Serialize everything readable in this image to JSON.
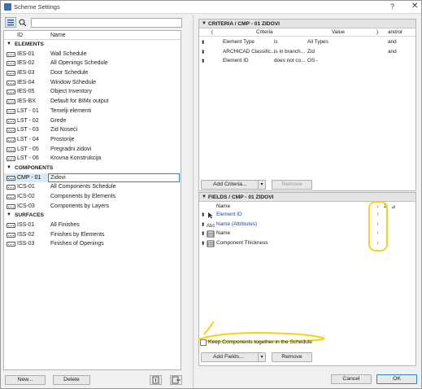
{
  "window": {
    "title": "Scheme Settings",
    "help": "?",
    "close": "✕"
  },
  "left": {
    "headers": {
      "id": "ID",
      "name": "Name"
    },
    "categories": {
      "elements": "ELEMENTS",
      "components": "COMPONENTS",
      "surfaces": "SURFACES"
    },
    "elements": [
      {
        "id": "IES-01",
        "name": "Wall Schedule"
      },
      {
        "id": "IES-02",
        "name": "All Openings Schedule"
      },
      {
        "id": "IES-03",
        "name": "Door Schedule"
      },
      {
        "id": "IES-04",
        "name": "Window Schedule"
      },
      {
        "id": "IES-05",
        "name": "Object Inventory"
      },
      {
        "id": "IES-BX",
        "name": "Default for BIMx output"
      },
      {
        "id": "LST - 01",
        "name": "Temelji elementi"
      },
      {
        "id": "LST - 02",
        "name": "Grede"
      },
      {
        "id": "LST - 03",
        "name": "Zid Noseći"
      },
      {
        "id": "LST - 04",
        "name": "Prostorije"
      },
      {
        "id": "LST - 05",
        "name": "Pregradni zidovi"
      },
      {
        "id": "LST - 06",
        "name": "Krovna Konstrukcija"
      }
    ],
    "components": [
      {
        "id": "CMP - 01",
        "name": "Zidovi"
      },
      {
        "id": "ICS-01",
        "name": "All Components Schedule"
      },
      {
        "id": "ICS-02",
        "name": "Components by Elements"
      },
      {
        "id": "ICS-03",
        "name": "Components by Layers"
      }
    ],
    "surfaces": [
      {
        "id": "ISS-01",
        "name": "All Finishes"
      },
      {
        "id": "ISS-02",
        "name": "Finishes by Elements"
      },
      {
        "id": "ISS-03",
        "name": "Finishes of Openings"
      }
    ],
    "new_label": "New...",
    "delete_label": "Delete"
  },
  "criteria": {
    "title": "CRITERIA / CMP - 01 ZIDOVI",
    "headers": {
      "open": "(",
      "criteria": "Criteria",
      "value": "Value",
      "close": ")",
      "andor": "and/or"
    },
    "rows": [
      {
        "field": "Element Type",
        "op": "is",
        "value": "All Types",
        "andor": "and"
      },
      {
        "field": "ARCHICAD Classific...",
        "op": "is in branch...",
        "value": "Zid",
        "andor": "and"
      },
      {
        "field": "Element ID",
        "op": "does not co...",
        "value": "OS -",
        "andor": ""
      }
    ],
    "add_label": "Add Criteria...",
    "remove_label": "Remove"
  },
  "fields": {
    "title": "FIELDS / CMP - 01 ZIDOVI",
    "headers": {
      "name": "Name",
      "sort": "↓",
      "sum": "Σ"
    },
    "rows": [
      {
        "type": "arrow-icon",
        "name": "Element ID",
        "blue": true,
        "sort": "↑"
      },
      {
        "type": "abc-icon",
        "name": "Name (Attributes)",
        "blue": true,
        "sort": "↑"
      },
      {
        "type": "layers-icon",
        "name": "Name",
        "blue": false,
        "sort": "↑"
      },
      {
        "type": "layers-icon",
        "name": "Component Thickness",
        "blue": false,
        "sort": "↓"
      }
    ],
    "keep_label": "Keep Components together in the Schedule",
    "add_label": "Add Fields...",
    "remove_label": "Remove"
  },
  "footer": {
    "cancel_label": "Cancel",
    "ok_label": "OK"
  },
  "colors": {
    "selection": "#dceaf8",
    "accent": "#2d7fd3",
    "highlight": "#f3d21a",
    "link": "#2340a8"
  }
}
